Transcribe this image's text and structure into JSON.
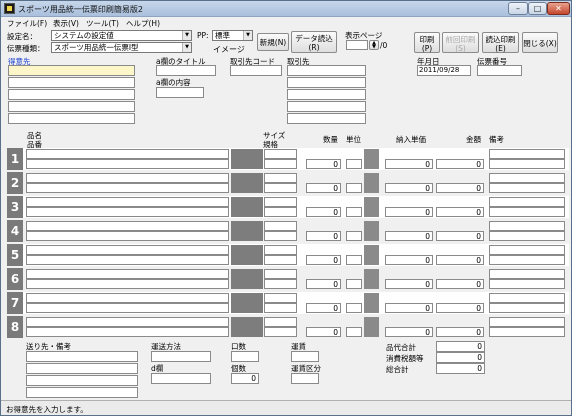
{
  "window": {
    "title": "スポーツ用品統一伝票印刷簡易版2",
    "min": "–",
    "max": "□",
    "close": "✕",
    "icon": "app-icon"
  },
  "menu": [
    "ファイル(F)",
    "表示(V)",
    "ツール(T)",
    "ヘルプ(H)"
  ],
  "toolbar": {
    "settings_label": "設定名：",
    "settings_value": "システムの設定値",
    "type_label": "伝票種類：",
    "type_value": "スポーツ用品統一伝票Ⅰ型",
    "pp_label": "PP:",
    "pp_value": "標準",
    "image_label": "イメージ",
    "new_label": "新規(N)",
    "load_label": "データ読込(R)",
    "page_label": "表示ページ",
    "page_total": "/0",
    "print_label": "印刷(P)",
    "prev_print_label": "前回印刷(S)",
    "load_print_label": "読込印刷(E)",
    "close_label": "閉じる(X)"
  },
  "header": {
    "customer_label": "得意先",
    "a_title_label": "a欄のタイトル",
    "a_content_label": "a欄の内容",
    "trade_code_label": "取引先コード",
    "trade_label": "取引先",
    "date_label": "年月日",
    "date_value": "2011/09/28",
    "slip_no_label": "伝票番号"
  },
  "columns": {
    "name": "品名",
    "number": "品番",
    "size_label": "サイズ",
    "size_spec": "規格",
    "qty": "数量",
    "unit": "単位",
    "unit_price": "納入単価",
    "amount": "金額",
    "note": "備考"
  },
  "rows": [
    {
      "n": "1",
      "qty": "0",
      "price": "0",
      "amount": "0"
    },
    {
      "n": "2",
      "qty": "0",
      "price": "0",
      "amount": "0"
    },
    {
      "n": "3",
      "qty": "0",
      "price": "0",
      "amount": "0"
    },
    {
      "n": "4",
      "qty": "0",
      "price": "0",
      "amount": "0"
    },
    {
      "n": "5",
      "qty": "0",
      "price": "0",
      "amount": "0"
    },
    {
      "n": "6",
      "qty": "0",
      "price": "0",
      "amount": "0"
    },
    {
      "n": "7",
      "qty": "0",
      "price": "0",
      "amount": "0"
    },
    {
      "n": "8",
      "qty": "0",
      "price": "0",
      "amount": "0"
    }
  ],
  "footer": {
    "ship_label": "送り先・備考",
    "method_label": "運送方法",
    "d_label": "d欄",
    "kuchi_label": "口数",
    "count_label": "個数",
    "count_value": "0",
    "fare_label": "運賃",
    "fare_kubun_label": "運賃区分",
    "subtotal_label": "品代合計",
    "subtotal_value": "0",
    "tax_label": "消費税額等",
    "tax_value": "0",
    "total_label": "総合計",
    "total_value": "0"
  },
  "status": "お得意先を入力します。"
}
